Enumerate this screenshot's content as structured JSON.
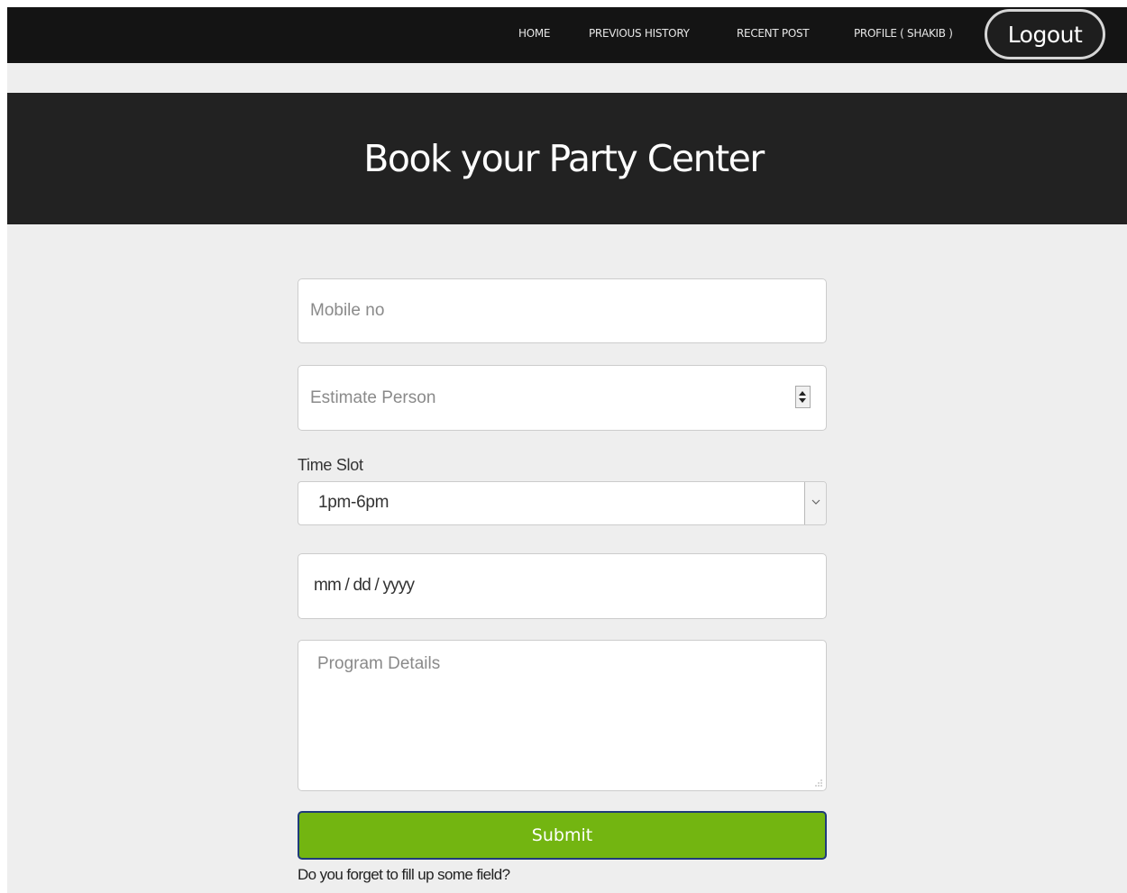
{
  "nav": {
    "home": "HOME",
    "previous_history": "PREVIOUS HISTORY",
    "recent_post": "RECENT POST",
    "profile": "PROFILE ( SHAKIB )",
    "logout": "Logout"
  },
  "banner": {
    "title": "Book your Party Center"
  },
  "form": {
    "mobile_placeholder": "Mobile no",
    "estimate_placeholder": "Estimate Person",
    "time_slot_label": "Time Slot",
    "time_slot_selected": "1pm-6pm",
    "date_placeholder": "mm / dd / yyyy",
    "details_placeholder": "Program Details",
    "submit_label": "Submit",
    "hint": "Do you forget to fill up some field?"
  },
  "colors": {
    "navbar": "#141414",
    "banner": "#222222",
    "background": "#eeeeee",
    "submit": "#73b511",
    "submit_border": "#1f3a7a"
  },
  "icons": {
    "spinner": "number-spinner-icon",
    "select_arrow": "chevron-down-icon",
    "resize": "resize-grip-icon"
  }
}
